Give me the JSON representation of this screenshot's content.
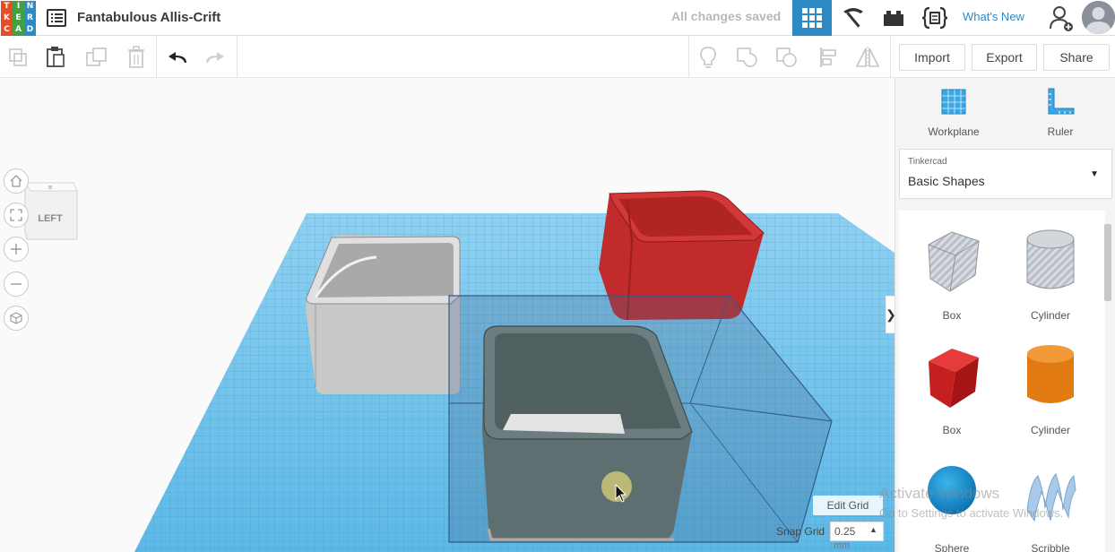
{
  "logo": {
    "letters": [
      "T",
      "I",
      "N",
      "K",
      "E",
      "R",
      "C",
      "A",
      "D"
    ],
    "colors": [
      "#e44d26",
      "#3fa13f",
      "#2d8ac4",
      "#e44d26",
      "#3fa13f",
      "#2d8ac4",
      "#e44d26",
      "#3fa13f",
      "#2d8ac4"
    ]
  },
  "header": {
    "title": "Fantabulous Allis-Crift",
    "status": "All changes saved",
    "whats_new": "What's New",
    "accent": "#2d8ac4"
  },
  "toolbar": {
    "import_label": "Import",
    "export_label": "Export",
    "share_label": "Share"
  },
  "viewcube": {
    "face_label": "LEFT"
  },
  "viewport": {
    "edit_grid_label": "Edit Grid",
    "snap_grid_label": "Snap Grid",
    "snap_grid_value": "0.25",
    "snap_grid_unit": "mm",
    "grid_color": "#4fb3e6"
  },
  "watermark": {
    "line1": "Activate Windows",
    "line2": "Go to Settings to activate Windows."
  },
  "panel": {
    "workplane_label": "Workplane",
    "ruler_label": "Ruler",
    "library_small": "Tinkercad",
    "library_name": "Basic Shapes",
    "shapes": [
      {
        "label": "Box",
        "icon": "box-hole-icon"
      },
      {
        "label": "Cylinder",
        "icon": "cylinder-hole-icon"
      },
      {
        "label": "Box",
        "icon": "box-solid-icon"
      },
      {
        "label": "Cylinder",
        "icon": "cylinder-solid-icon"
      },
      {
        "label": "Sphere",
        "icon": "sphere-icon"
      },
      {
        "label": "Scribble",
        "icon": "scribble-icon"
      }
    ]
  }
}
